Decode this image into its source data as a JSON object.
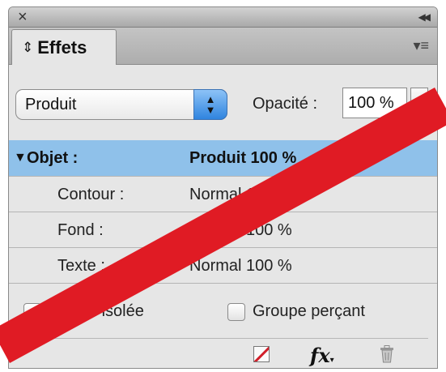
{
  "panel": {
    "title_icons": {
      "close": "close-icon",
      "collapse": "double-chevron-icon"
    },
    "tab": {
      "arrows_icon": "updown-arrows-icon",
      "label": "Effets"
    },
    "menu_icon": "panel-menu-icon"
  },
  "blend": {
    "selected": "Produit",
    "opacity_label": "Opacité :",
    "opacity_value": "100 %"
  },
  "rows": [
    {
      "label": "Objet :",
      "value": "Produit 100 %",
      "selected": true
    },
    {
      "label": "Contour :",
      "value": "Normal 100 %"
    },
    {
      "label": "Fond :",
      "value": "Normal 100 %"
    },
    {
      "label": "Texte :",
      "value": "Normal 100 %"
    }
  ],
  "options": {
    "isolate_label": "Fusion isolée",
    "knockout_label": "Groupe perçant"
  },
  "footer": {
    "clear_icon": "clear-effects-icon",
    "fx_label": "fx",
    "trash_icon": "trash-icon"
  },
  "colors": {
    "selection": "#8fc1ea",
    "overlay_slash": "#e01b24",
    "stepper_accent": "#2f84df"
  }
}
